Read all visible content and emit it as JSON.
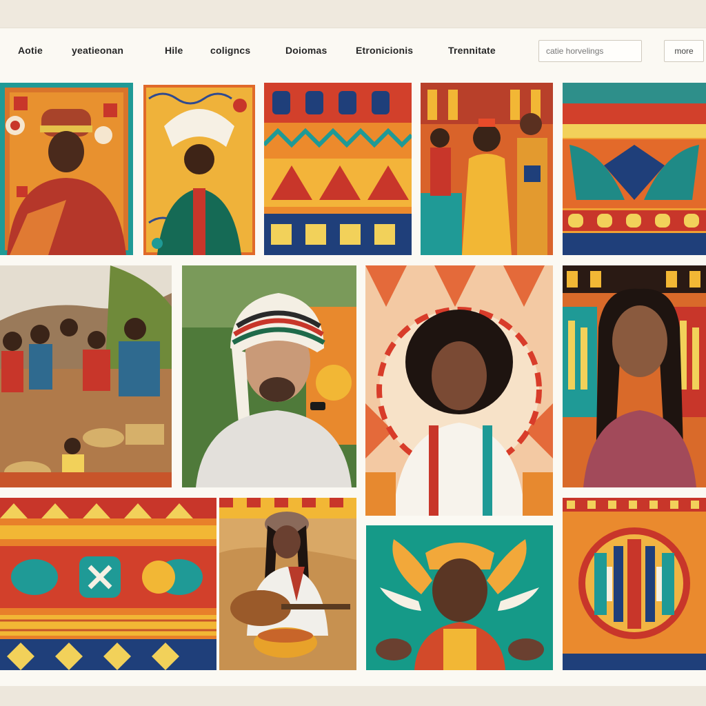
{
  "nav": {
    "items": [
      "Aotie",
      "yeatieonan",
      "Hile",
      "coligncs",
      "Doiomas",
      "Etronicionis",
      "Trennitate"
    ]
  },
  "search": {
    "placeholder": "catie horvelings"
  },
  "more_button": {
    "label": "more"
  },
  "palette": {
    "orange": "#e8802a",
    "red": "#c8362a",
    "teal": "#1f9a96",
    "yellow": "#f2b735",
    "navy": "#243b6b",
    "cream": "#f3ede2"
  },
  "gallery": {
    "tiles": [
      {
        "name": "tile-portrait-red-shawl",
        "subject": "portrait",
        "icon": "portrait-thumbnail"
      },
      {
        "name": "tile-portrait-headdress",
        "subject": "portrait",
        "icon": "portrait-thumbnail"
      },
      {
        "name": "tile-pattern-tribal",
        "subject": "pattern",
        "icon": "pattern-thumbnail"
      },
      {
        "name": "tile-mural-figures",
        "subject": "mural",
        "icon": "mural-thumbnail"
      },
      {
        "name": "tile-pattern-wings",
        "subject": "pattern",
        "icon": "pattern-thumbnail"
      },
      {
        "name": "tile-photo-basket-weavers",
        "subject": "photo",
        "icon": "photo-thumbnail"
      },
      {
        "name": "tile-photo-striped-turban",
        "subject": "photo",
        "icon": "photo-thumbnail"
      },
      {
        "name": "tile-portrait-sunburst",
        "subject": "portrait",
        "icon": "portrait-thumbnail"
      },
      {
        "name": "tile-portrait-braids",
        "subject": "portrait",
        "icon": "portrait-thumbnail"
      },
      {
        "name": "tile-pattern-woven",
        "subject": "pattern",
        "icon": "pattern-thumbnail"
      },
      {
        "name": "tile-photo-guitar-player",
        "subject": "photo",
        "icon": "photo-thumbnail"
      },
      {
        "name": "tile-portrait-winged-teal",
        "subject": "portrait",
        "icon": "portrait-thumbnail"
      },
      {
        "name": "tile-pattern-circle",
        "subject": "pattern",
        "icon": "pattern-thumbnail"
      }
    ]
  }
}
